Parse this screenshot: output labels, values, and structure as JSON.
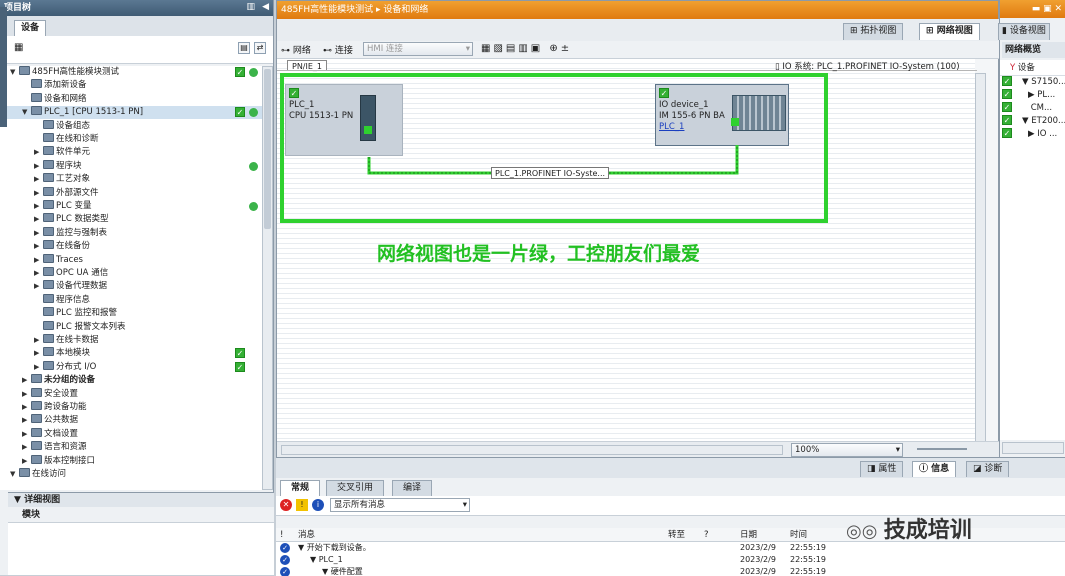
{
  "left": {
    "panel_title": "项目树",
    "tab": "设备",
    "tree": [
      {
        "label": "485FH高性能模块测试",
        "indent": 0,
        "arrow": "▼",
        "check": true,
        "dot": true
      },
      {
        "label": "添加新设备",
        "indent": 1,
        "arrow": ""
      },
      {
        "label": "设备和网络",
        "indent": 1,
        "arrow": ""
      },
      {
        "label": "PLC_1 [CPU 1513-1 PN]",
        "indent": 1,
        "arrow": "▼",
        "check": true,
        "dot": true,
        "selected": true
      },
      {
        "label": "设备组态",
        "indent": 2,
        "arrow": ""
      },
      {
        "label": "在线和诊断",
        "indent": 2,
        "arrow": ""
      },
      {
        "label": "软件单元",
        "indent": 2,
        "arrow": "▶"
      },
      {
        "label": "程序块",
        "indent": 2,
        "arrow": "▶",
        "dot": true
      },
      {
        "label": "工艺对象",
        "indent": 2,
        "arrow": "▶"
      },
      {
        "label": "外部源文件",
        "indent": 2,
        "arrow": "▶"
      },
      {
        "label": "PLC 变量",
        "indent": 2,
        "arrow": "▶",
        "dot": true
      },
      {
        "label": "PLC 数据类型",
        "indent": 2,
        "arrow": "▶"
      },
      {
        "label": "监控与强制表",
        "indent": 2,
        "arrow": "▶"
      },
      {
        "label": "在线备份",
        "indent": 2,
        "arrow": "▶"
      },
      {
        "label": "Traces",
        "indent": 2,
        "arrow": "▶"
      },
      {
        "label": "OPC UA 通信",
        "indent": 2,
        "arrow": "▶"
      },
      {
        "label": "设备代理数据",
        "indent": 2,
        "arrow": "▶"
      },
      {
        "label": "程序信息",
        "indent": 2,
        "arrow": ""
      },
      {
        "label": "PLC 监控和报警",
        "indent": 2,
        "arrow": ""
      },
      {
        "label": "PLC 报警文本列表",
        "indent": 2,
        "arrow": ""
      },
      {
        "label": "在线卡数据",
        "indent": 2,
        "arrow": "▶"
      },
      {
        "label": "本地模块",
        "indent": 2,
        "arrow": "▶",
        "check": true
      },
      {
        "label": "分布式 I/O",
        "indent": 2,
        "arrow": "▶",
        "check": true
      },
      {
        "label": "未分组的设备",
        "indent": 1,
        "arrow": "▶",
        "bold": true
      },
      {
        "label": "安全设置",
        "indent": 1,
        "arrow": "▶"
      },
      {
        "label": "跨设备功能",
        "indent": 1,
        "arrow": "▶"
      },
      {
        "label": "公共数据",
        "indent": 1,
        "arrow": "▶"
      },
      {
        "label": "文档设置",
        "indent": 1,
        "arrow": "▶"
      },
      {
        "label": "语言和资源",
        "indent": 1,
        "arrow": "▶"
      },
      {
        "label": "版本控制接口",
        "indent": 1,
        "arrow": "▶"
      },
      {
        "label": "在线访问",
        "indent": 0,
        "arrow": "▼"
      }
    ],
    "detail_title": "详细视图",
    "detail_col": "模块"
  },
  "main": {
    "title": "485FH高性能模块测试 ▸ 设备和网络",
    "view_tabs": [
      "拓扑视图",
      "网络视图",
      "设备视图"
    ],
    "toolbar": {
      "network": "网络",
      "connect": "连接",
      "hmi_conn": "HMI 连接"
    },
    "subnet_tag": "PN/IE_1",
    "io_system": "IO 系统: PLC_1.PROFINET IO-System (100)",
    "plc": {
      "name": "PLC_1",
      "type": "CPU 1513-1 PN"
    },
    "io": {
      "name": "IO device_1",
      "type": "IM 155-6 PN BA",
      "link": "PLC_1"
    },
    "network_label": "PLC_1.PROFINET IO-Syste...",
    "caption": "网络视图也是一片绿，工控朋友们最爱",
    "zoom": "100%"
  },
  "right": {
    "tab": "网络概览",
    "header": "设备",
    "items": [
      {
        "label": "S7150...",
        "indent": 1,
        "arrow": "▼"
      },
      {
        "label": "PL...",
        "indent": 2,
        "arrow": "▶"
      },
      {
        "label": "CM...",
        "indent": 2,
        "arrow": ""
      },
      {
        "label": "ET200...",
        "indent": 1,
        "arrow": "▼"
      },
      {
        "label": "IO ...",
        "indent": 2,
        "arrow": "▶"
      }
    ]
  },
  "bottom": {
    "tabs": [
      "常规",
      "交叉引用",
      "编译"
    ],
    "right_tabs": [
      "属性",
      "信息",
      "诊断"
    ],
    "filter": "显示所有消息",
    "columns": [
      "!",
      "消息",
      "转至",
      "?",
      "日期",
      "时间"
    ],
    "rows": [
      {
        "msg": "▼ 开始下载到设备。",
        "date": "2023/2/9",
        "time": "22:55:19"
      },
      {
        "msg": "▼ PLC_1",
        "date": "2023/2/9",
        "time": "22:55:19"
      },
      {
        "msg": "▼ 硬件配置",
        "date": "2023/2/9",
        "time": "22:55:19"
      }
    ]
  },
  "watermark": "技成培训",
  "colors": {
    "highlight": "#2fd12f",
    "caption": "#22c022",
    "orange": "#e88a1a"
  }
}
